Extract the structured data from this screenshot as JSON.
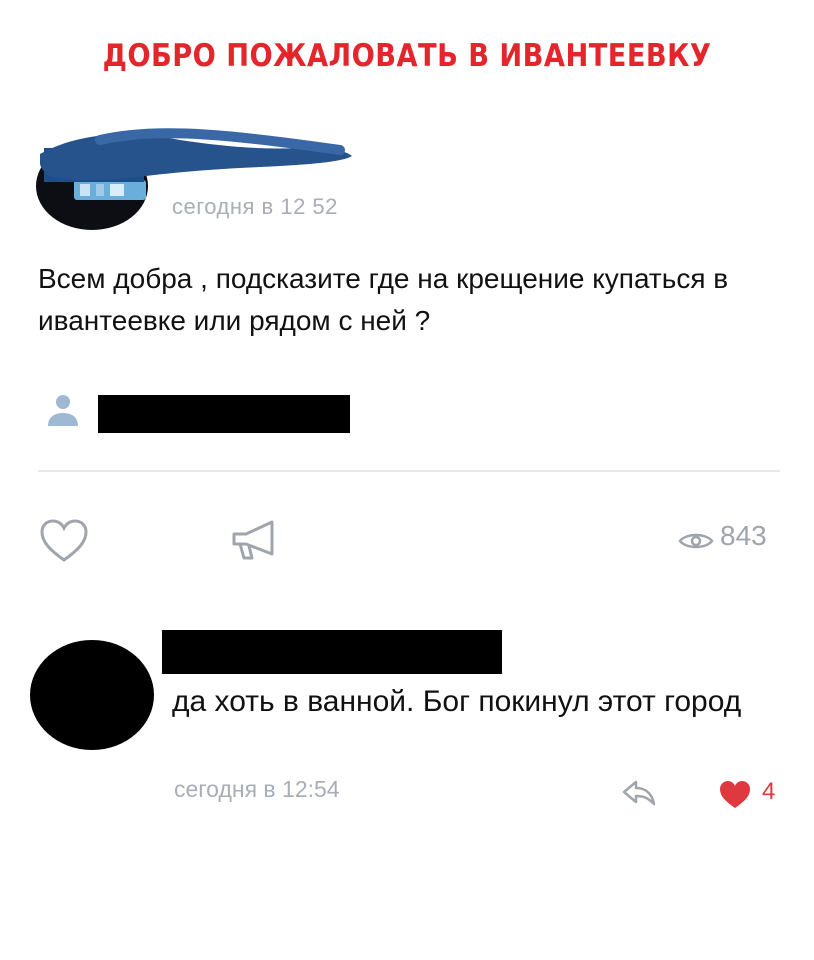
{
  "headline": "ДОБРО ПОЖАЛОВАТЬ В ИВАНТЕЕВКУ",
  "colors": {
    "headline": "#e3262c",
    "accent_blue": "#3d6fb3",
    "muted": "#a9aeb6",
    "like_red": "#e0383f"
  },
  "post": {
    "time": "сегодня в 12 52",
    "text": "Всем добра , подсказите где на крещение купаться в ивантеевке или рядом с ней ?",
    "views": "843",
    "icons": {
      "like": "heart-outline-icon",
      "share": "megaphone-icon",
      "views": "eye-icon",
      "mention": "user-icon"
    }
  },
  "comment": {
    "text": "да хоть в ванной. Бог покинул этот город",
    "time": "сегодня в 12:54",
    "likes": "4",
    "icons": {
      "reply": "reply-arrow-icon",
      "like": "heart-filled-icon"
    }
  }
}
